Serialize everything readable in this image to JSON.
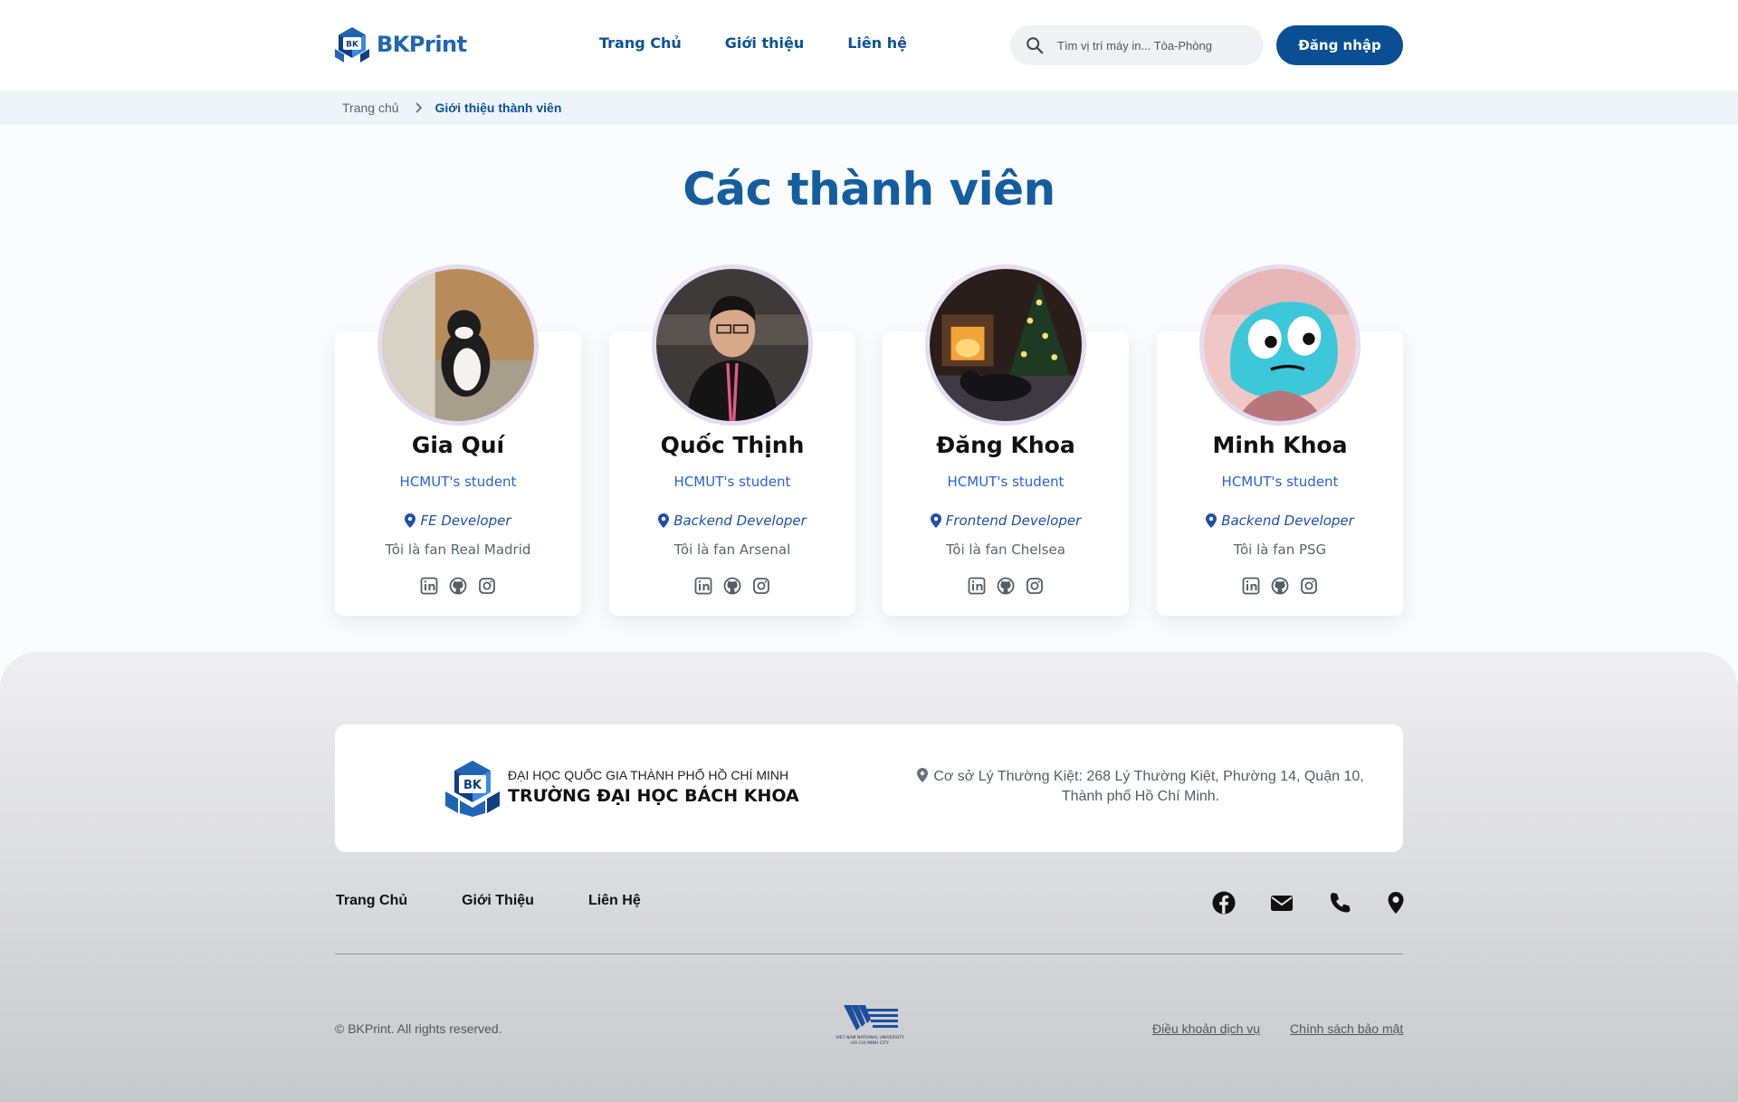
{
  "brand": {
    "name": "BKPrint",
    "logo_text": "BK",
    "color": "#1f65b3"
  },
  "nav": {
    "items": [
      "Trang Chủ",
      "Giới thiệu",
      "Liên hệ"
    ]
  },
  "search": {
    "placeholder": "Tìm vị trí máy in... Tòa-Phòng",
    "icon": "search-icon"
  },
  "auth": {
    "login_label": "Đăng nhập"
  },
  "breadcrumb": {
    "home": "Trang chủ",
    "current": "Giới thiệu thành viên"
  },
  "page": {
    "title": "Các thành viên"
  },
  "members": [
    {
      "name": "Gia Quí",
      "school": "HCMUT's student",
      "role": "FE Developer",
      "fan": "Tôi là fan Real Madrid",
      "avatar": "cat-photo"
    },
    {
      "name": "Quốc Thịnh",
      "school": "HCMUT's student",
      "role": "Backend Developer",
      "fan": "Tôi là fan Arsenal",
      "avatar": "person-photo"
    },
    {
      "name": "Đăng Khoa",
      "school": "HCMUT's student",
      "role": "Frontend Developer",
      "fan": "Tôi là fan Chelsea",
      "avatar": "cat-fireplace-photo"
    },
    {
      "name": "Minh Khoa",
      "school": "HCMUT's student",
      "role": "Backend Developer",
      "fan": "Tôi là fan PSG",
      "avatar": "cartoon-fish-photo"
    }
  ],
  "social_icons": [
    "linkedin-icon",
    "github-icon",
    "instagram-icon"
  ],
  "footer": {
    "university_line1": "ĐẠI HỌC QUỐC GIA THÀNH PHỐ HỒ CHÍ MINH",
    "university_line2": "TRƯỜNG ĐẠI HỌC BÁCH KHOA",
    "address_line1": "Cơ sở Lý Thường Kiệt: 268 Lý Thường Kiệt, Phường 14, Quận 10,",
    "address_line2": "Thành phố Hồ Chí Minh.",
    "links": [
      "Trang Chủ",
      "Giới Thiệu",
      "Liên Hệ"
    ],
    "contact_icons": [
      "facebook-icon",
      "mail-icon",
      "phone-icon",
      "location-icon"
    ],
    "copyright": "© BKPrint. All rights reserved.",
    "vnu_text_1": "VIET NAM NATIONAL UNIVERSITY",
    "vnu_text_2": "HO CHI MINH CITY",
    "terms": "Điều khoản dịch vụ",
    "privacy": "Chính sách bảo mật"
  }
}
